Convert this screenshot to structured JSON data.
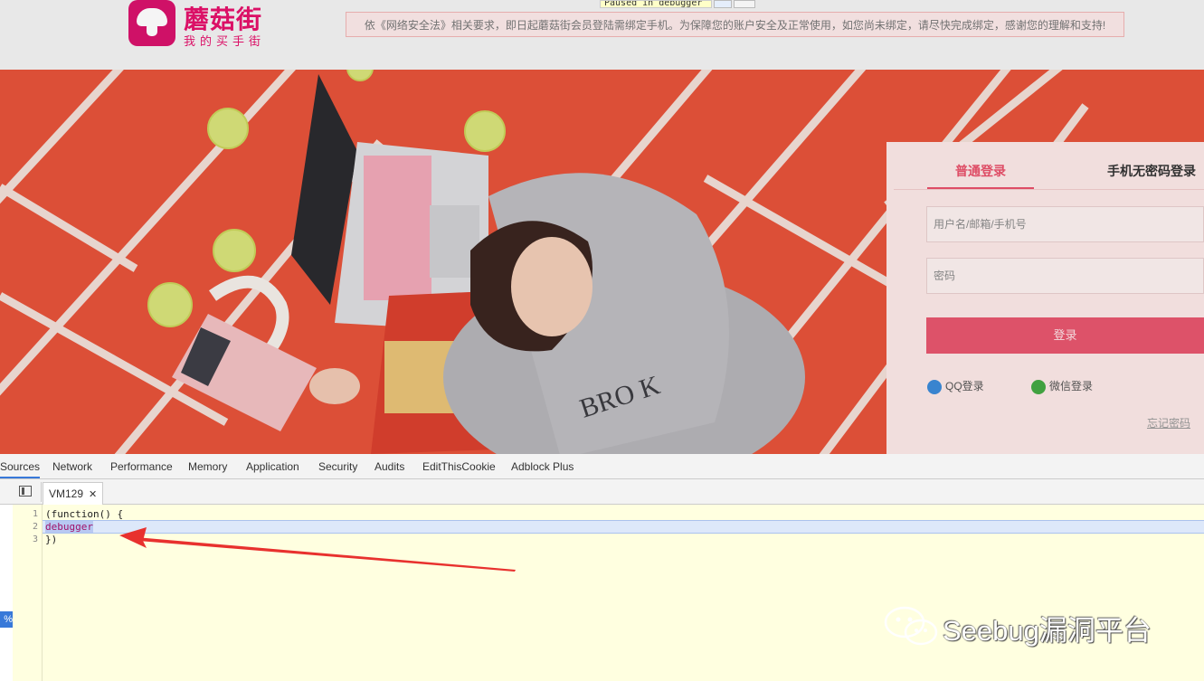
{
  "header": {
    "logo_name": "蘑菇街",
    "logo_slogan": "我的买手街",
    "notice": "依《网络安全法》相关要求，即日起蘑菇街会员登陆需绑定手机。为保障您的账户安全及正常使用，如您尚未绑定，请尽快完成绑定，感谢您的理解和支持!"
  },
  "debug_overlay": {
    "paused_text": "Paused in debugger"
  },
  "login": {
    "tabs": [
      "普通登录",
      "手机无密码登录"
    ],
    "active_tab": 0,
    "username_placeholder": "用户名/邮箱/手机号",
    "password_placeholder": "密码",
    "login_button": "登录",
    "qq_login": "QQ登录",
    "wechat_login": "微信登录",
    "forgot_password": "忘记密码"
  },
  "devtools": {
    "tabs": [
      "Sources",
      "Network",
      "Performance",
      "Memory",
      "Application",
      "Security",
      "Audits",
      "EditThisCookie",
      "Adblock Plus"
    ],
    "active_tab": "Sources",
    "open_file": "VM129",
    "percent_badge": "%",
    "code_lines": [
      {
        "num": "1",
        "text": "(function() {"
      },
      {
        "num": "2",
        "text": "debugger"
      },
      {
        "num": "3",
        "text": "})"
      }
    ],
    "highlighted_line": 2
  },
  "watermark": {
    "text": "Seebug漏洞平台"
  },
  "colors": {
    "brand_pink": "#d8126c",
    "hero_red": "#e5533a",
    "login_button": "#e6566e",
    "devtools_accent": "#3879d9",
    "arrow_red": "#e8312e"
  }
}
